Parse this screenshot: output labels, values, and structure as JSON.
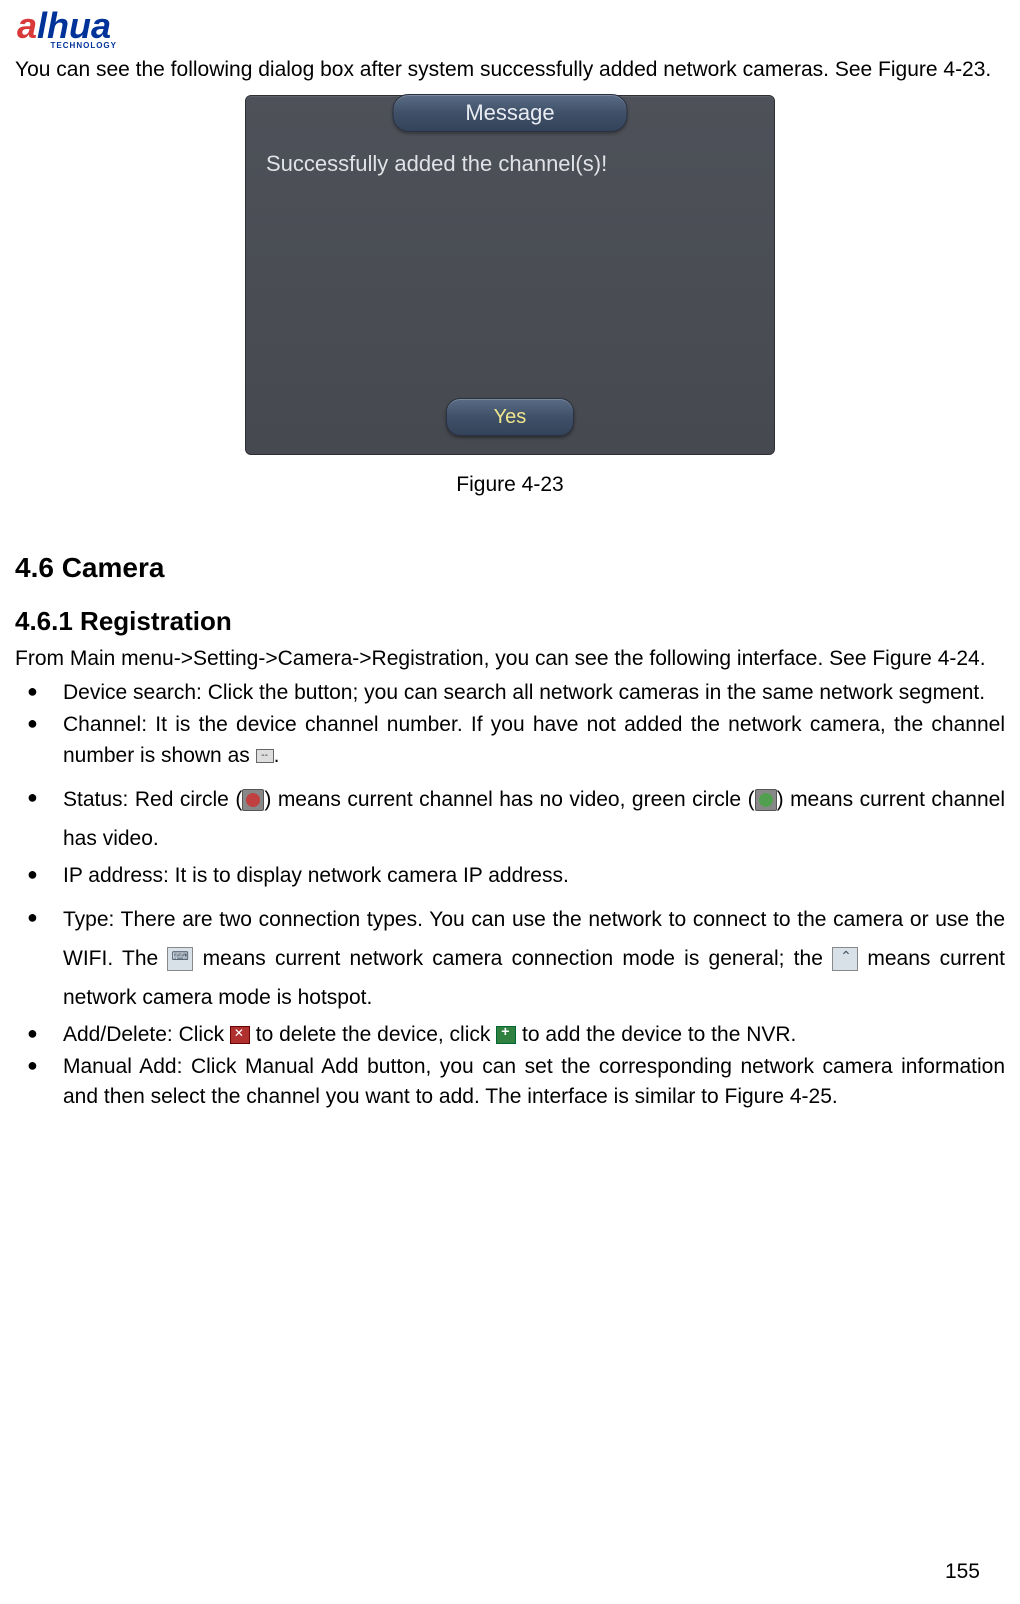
{
  "logo": {
    "brand_prefix": "a",
    "brand_suffix": "lhua",
    "tagline": "TECHNOLOGY"
  },
  "intro": "You can see the following dialog box after system successfully added network cameras. See Figure 4-23.",
  "dialog": {
    "title": "Message",
    "message": "Successfully added the channel(s)!",
    "yes": "Yes"
  },
  "figure_caption": "Figure 4-23",
  "section": "4.6  Camera",
  "subsection": "4.6.1  Registration",
  "body1": "From Main menu->Setting->Camera->Registration, you can see the following interface. See Figure 4-24.",
  "bullets": {
    "device_search": "Device search: Click the button; you can search all network cameras in the same network segment.",
    "channel_p1": "Channel: It is the device channel number. If you have not added the network camera, the channel number is shown as",
    "channel_p2": ".",
    "status_p1": "Status: Red circle (",
    "status_p2": ") means current channel has no video, green circle (",
    "status_p3": ") means current channel has video.",
    "ip": "IP address: It is to display network camera IP address.",
    "type_p1": "Type: There are two connection types. You can use the network to connect to the camera or use the WIFI. The ",
    "type_p2": " means current network camera connection mode is general; the ",
    "type_p3": " means current network camera mode is hotspot.",
    "adddel_p1": "Add/Delete: Click ",
    "adddel_p2": " to delete the device, click ",
    "adddel_p3": " to add the device to the NVR.",
    "manual": "Manual Add: Click Manual Add button, you can set the corresponding network camera information and then select the channel you want to add. The interface is similar to Figure 4-25."
  },
  "page_number": "155"
}
